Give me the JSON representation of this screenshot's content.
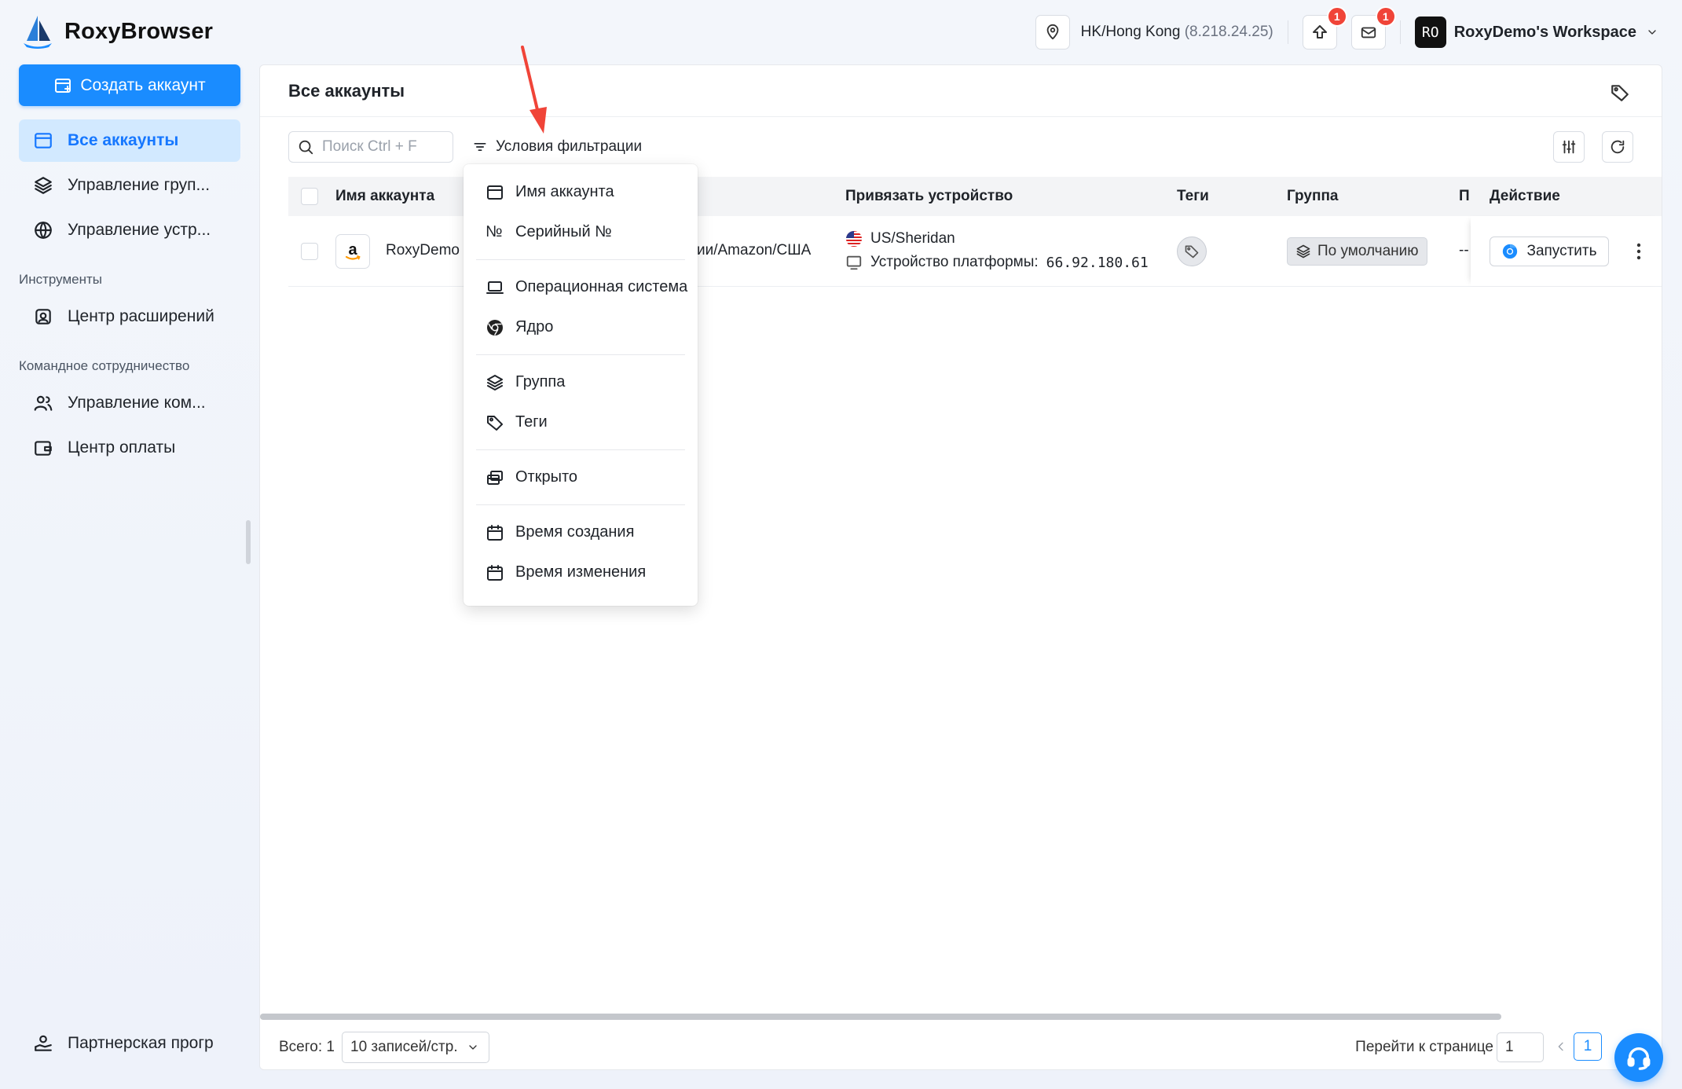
{
  "app": {
    "name": "RoxyBrowser"
  },
  "topbar": {
    "location": "HK/Hong Kong",
    "ip": "(8.218.24.25)",
    "upload_badge": "1",
    "mail_badge": "1",
    "workspace_avatar": "RO",
    "workspace_name": "RoxyDemo's Workspace"
  },
  "sidebar": {
    "create_button": "Создать аккаунт",
    "items": [
      {
        "label": "Все аккаунты"
      },
      {
        "label": "Управление груп..."
      },
      {
        "label": "Управление устр..."
      }
    ],
    "section_tools": "Инструменты",
    "tools_items": [
      {
        "label": "Центр расширений"
      }
    ],
    "section_team": "Командное сотрудничество",
    "team_items": [
      {
        "label": "Управление ком..."
      },
      {
        "label": "Центр оплаты"
      }
    ],
    "bottom_item": "Партнерская прогр"
  },
  "main": {
    "title": "Все аккаунты",
    "search_placeholder": "Поиск Ctrl + F",
    "filter_label": "Условия фильтрации",
    "columns": {
      "account": "Имя аккаунта",
      "device": "Привязать устройство",
      "tags": "Теги",
      "group": "Группа",
      "p": "П",
      "action": "Действие"
    },
    "rows": [
      {
        "account": "RoxyDemo",
        "platform": "ии/Amazon/США",
        "location": "US/Sheridan",
        "device_label": "Устройство платформы:",
        "device_ip": "66.92.180.61",
        "group": "По умолчанию",
        "p": "--",
        "run": "Запустить"
      }
    ]
  },
  "footer": {
    "total": "Всего: 1",
    "page_size": "10 записей/стр.",
    "goto_label": "Перейти к странице",
    "goto_value": "1",
    "current_page": "1"
  },
  "filter_menu": {
    "groups": [
      [
        {
          "label": "Имя аккаунта",
          "icon": "window-icon"
        },
        {
          "label": "Серийный №",
          "icon": "number-icon"
        }
      ],
      [
        {
          "label": "Операционная система",
          "icon": "laptop-icon"
        },
        {
          "label": "Ядро",
          "icon": "chrome-icon"
        }
      ],
      [
        {
          "label": "Группа",
          "icon": "layers-icon"
        },
        {
          "label": "Теги",
          "icon": "tag-icon"
        }
      ],
      [
        {
          "label": "Открыто",
          "icon": "windows-stack-icon"
        }
      ],
      [
        {
          "label": "Время создания",
          "icon": "calendar-icon"
        },
        {
          "label": "Время изменения",
          "icon": "calendar-icon"
        }
      ]
    ],
    "number_glyph": "№"
  },
  "colors": {
    "accent": "#1a8cff",
    "active_nav_bg": "#d2e9ff",
    "badge": "#f04438",
    "annotation": "#f04438"
  }
}
